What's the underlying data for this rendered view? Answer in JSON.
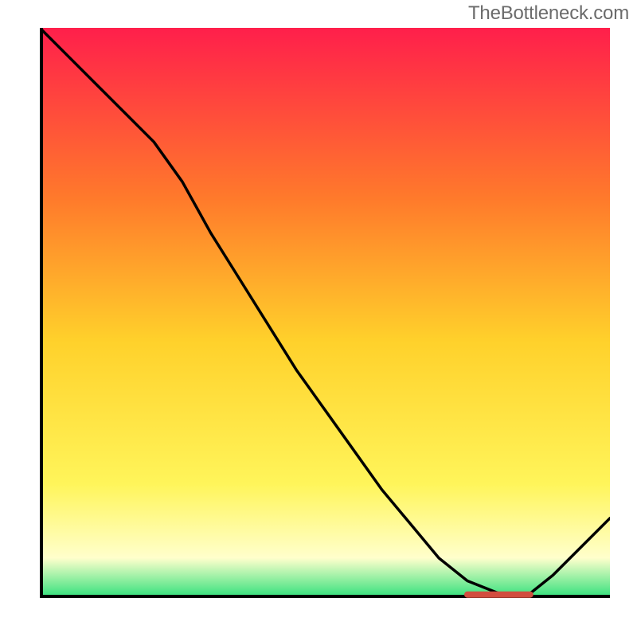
{
  "watermark": "TheBottleneck.com",
  "colors": {
    "gradient_top": "#ff1f4b",
    "gradient_mid_upper": "#ff7a2b",
    "gradient_mid": "#ffd12b",
    "gradient_mid_lower": "#fff55a",
    "gradient_lower": "#ffffcc",
    "gradient_bottom": "#2fe07b",
    "curve": "#000000",
    "axis": "#000000",
    "marker": "#d24d3f"
  },
  "chart_data": {
    "type": "line",
    "title": "",
    "xlabel": "",
    "ylabel": "",
    "xlim": [
      0,
      100
    ],
    "ylim": [
      0,
      100
    ],
    "grid": false,
    "legend": false,
    "series": [
      {
        "name": "bottleneck-curve",
        "x": [
          0,
          5,
          10,
          15,
          20,
          25,
          30,
          35,
          40,
          45,
          50,
          55,
          60,
          65,
          70,
          75,
          80,
          83,
          85,
          90,
          100
        ],
        "y": [
          100,
          95,
          90,
          85,
          80,
          73,
          64,
          56,
          48,
          40,
          33,
          26,
          19,
          13,
          7,
          3,
          1,
          0,
          0,
          4,
          14
        ]
      }
    ],
    "annotations": [
      {
        "name": "optimal-marker",
        "x_start": 75,
        "x_end": 86,
        "y": 0.6
      }
    ]
  }
}
